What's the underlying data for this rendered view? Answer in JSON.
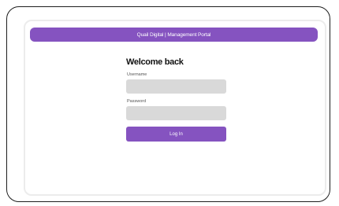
{
  "header": {
    "title": "Quail Digital | Management Portal"
  },
  "login": {
    "heading": "Welcome back",
    "username_label": "Username",
    "username_value": "",
    "password_label": "Password",
    "password_value": "",
    "submit_label": "Log In"
  },
  "colors": {
    "accent": "#8553c0",
    "field_bg": "#d9d9d9"
  }
}
